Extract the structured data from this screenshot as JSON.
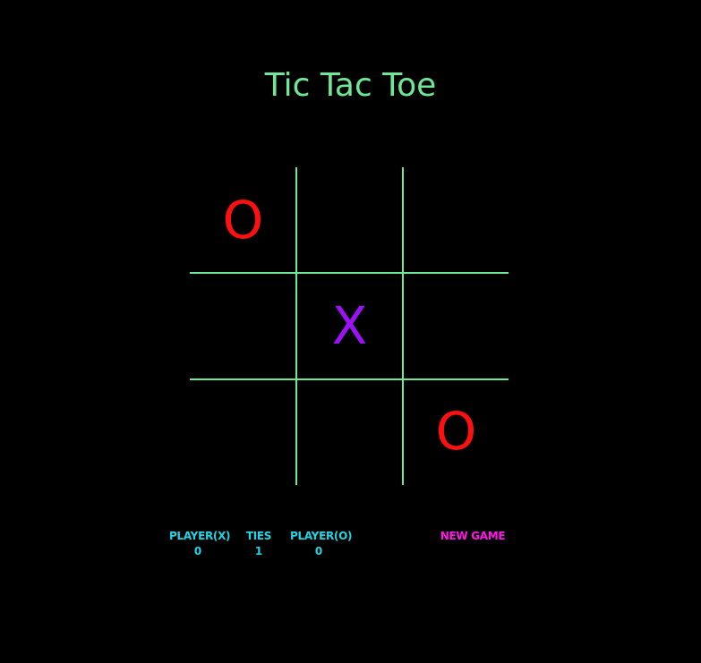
{
  "title": "Tic Tac Toe",
  "board": {
    "cells": [
      "O",
      "",
      "",
      "",
      "X",
      "",
      "",
      "",
      "O"
    ],
    "colors": {
      "X": "#9b12f5",
      "O": "#ff1010",
      "grid": "#6ee896"
    }
  },
  "scoreboard": {
    "player_x": {
      "label": "PLAYER(X)",
      "value": "0"
    },
    "ties": {
      "label": "TIES",
      "value": "1"
    },
    "player_o": {
      "label": "PLAYER(O)",
      "value": "0"
    }
  },
  "new_game_label": "NEW GAME",
  "colors": {
    "background": "#000000",
    "title": "#6ee896",
    "score": "#1fd6e6",
    "new_game": "#ff17e8"
  }
}
